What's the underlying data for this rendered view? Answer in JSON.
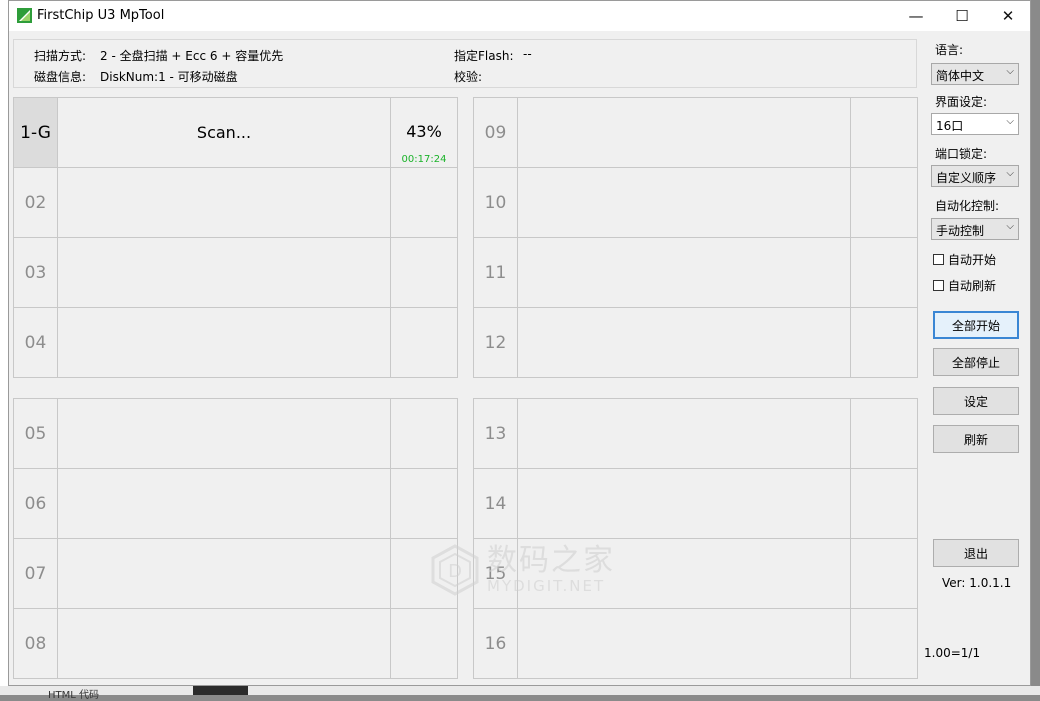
{
  "window": {
    "title": "FirstChip U3 MpTool",
    "min": "—",
    "max": "☐",
    "close": "✕"
  },
  "info": {
    "scan_mode_label": "扫描方式:",
    "scan_mode_value": "2 - 全盘扫描 + Ecc 6 + 容量优先",
    "disk_info_label": "磁盘信息:",
    "disk_info_value": "DiskNum:1 - 可移动磁盘",
    "flash_label": "指定Flash:",
    "flash_value": "--",
    "verify_label": "校验:",
    "verify_value": ""
  },
  "ports": [
    {
      "num": "1-G",
      "status": "Scan...",
      "percent": "43%",
      "time": "00:17:24",
      "progress": 43
    },
    {
      "num": "02",
      "status": "",
      "percent": "",
      "time": ""
    },
    {
      "num": "03",
      "status": "",
      "percent": "",
      "time": ""
    },
    {
      "num": "04",
      "status": "",
      "percent": "",
      "time": ""
    },
    {
      "num": "05",
      "status": "",
      "percent": "",
      "time": ""
    },
    {
      "num": "06",
      "status": "",
      "percent": "",
      "time": ""
    },
    {
      "num": "07",
      "status": "",
      "percent": "",
      "time": ""
    },
    {
      "num": "08",
      "status": "",
      "percent": "",
      "time": ""
    },
    {
      "num": "09",
      "status": "",
      "percent": "",
      "time": ""
    },
    {
      "num": "10",
      "status": "",
      "percent": "",
      "time": ""
    },
    {
      "num": "11",
      "status": "",
      "percent": "",
      "time": ""
    },
    {
      "num": "12",
      "status": "",
      "percent": "",
      "time": ""
    },
    {
      "num": "13",
      "status": "",
      "percent": "",
      "time": ""
    },
    {
      "num": "14",
      "status": "",
      "percent": "",
      "time": ""
    },
    {
      "num": "15",
      "status": "",
      "percent": "",
      "time": ""
    },
    {
      "num": "16",
      "status": "",
      "percent": "",
      "time": ""
    }
  ],
  "sidebar": {
    "language_label": "语言:",
    "language_value": "简体中文",
    "ui_label": "界面设定:",
    "ui_value": "16口",
    "port_lock_label": "端口锁定:",
    "port_lock_value": "自定义顺序",
    "auto_label": "自动化控制:",
    "auto_value": "手动控制",
    "auto_start": "自动开始",
    "auto_refresh": "自动刷新",
    "start_all": "全部开始",
    "stop_all": "全部停止",
    "settings": "设定",
    "refresh": "刷新",
    "exit": "退出",
    "version": "Ver: 1.0.1.1",
    "ratio": "1.00=1/1"
  },
  "watermark": {
    "cn": "数码之家",
    "en": "MYDIGIT.NET"
  },
  "background": {
    "bottom_text": "HTML 代码"
  },
  "colors": {
    "time_green": "#1bb32a",
    "focus_blue": "#3a86d4"
  }
}
